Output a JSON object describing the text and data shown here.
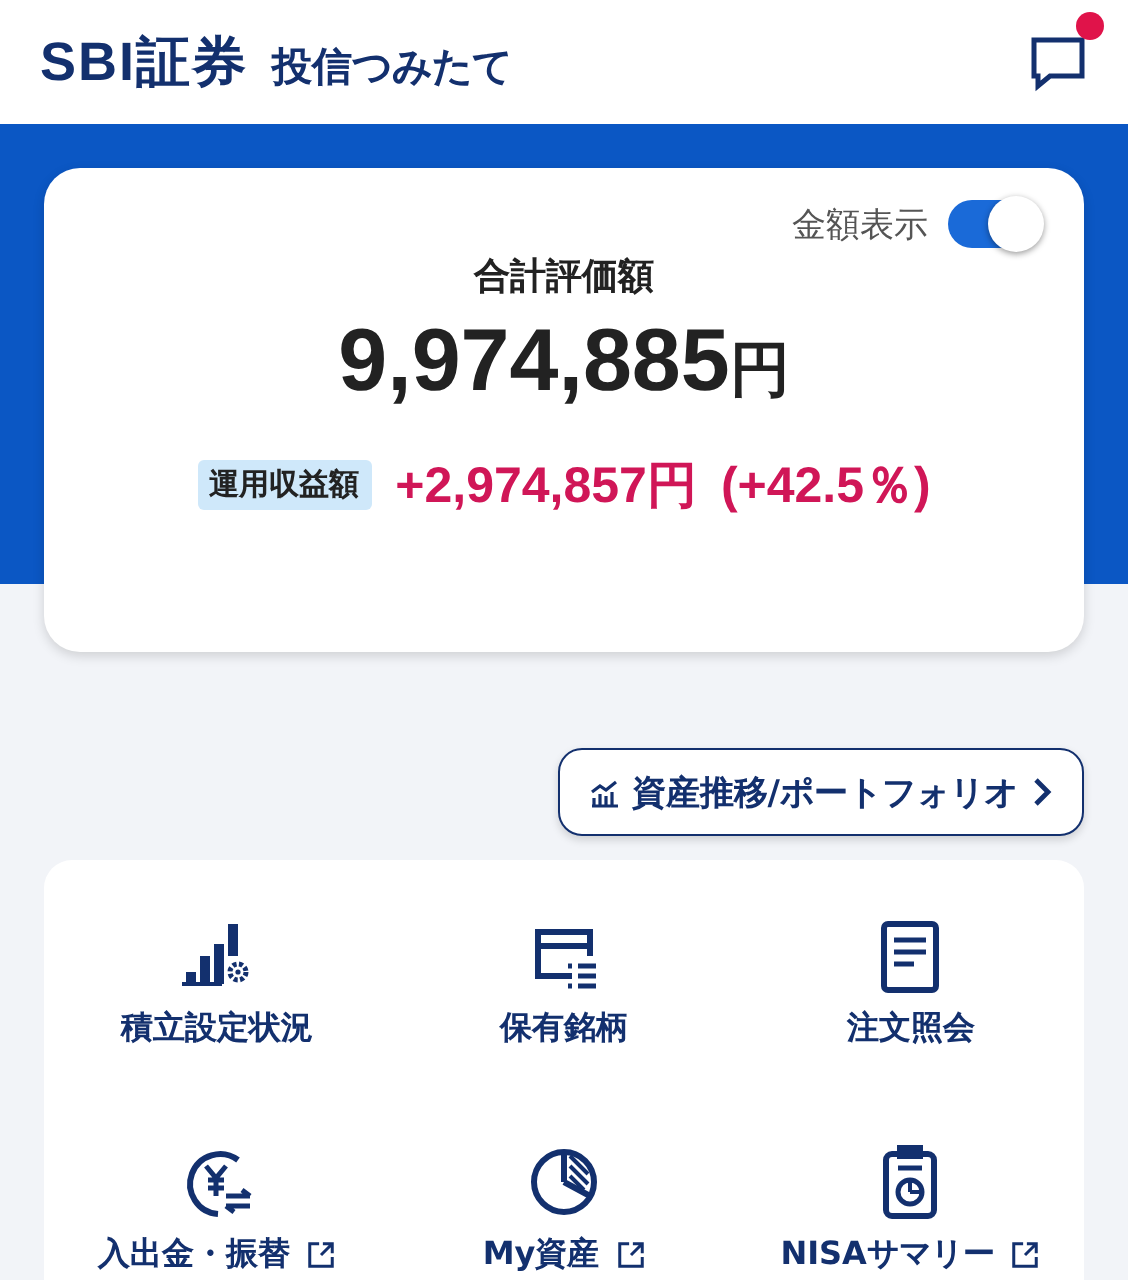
{
  "header": {
    "logo": "SBI証券",
    "title": "投信つみたて",
    "chat_unread": true
  },
  "summary": {
    "toggle": {
      "label": "金額表示",
      "on": true
    },
    "total_label": "合計評価額",
    "total_value": "9,974,885",
    "total_unit": "円",
    "profit_label": "運用収益額",
    "profit_value": "+2,974,857円",
    "profit_rate": "(+42.5％)"
  },
  "portfolio_button": {
    "label": "資産推移/ポートフォリオ"
  },
  "menu": [
    {
      "kind": "bars",
      "label": "積立設定状況",
      "external": false
    },
    {
      "kind": "card",
      "label": "保有銘柄",
      "external": false
    },
    {
      "kind": "document",
      "label": "注文照会",
      "external": false
    },
    {
      "kind": "yen",
      "label": "入出金・振替",
      "external": true
    },
    {
      "kind": "pie",
      "label": "My資産",
      "external": true
    },
    {
      "kind": "clipboard",
      "label": "NISAサマリー",
      "external": true
    }
  ]
}
